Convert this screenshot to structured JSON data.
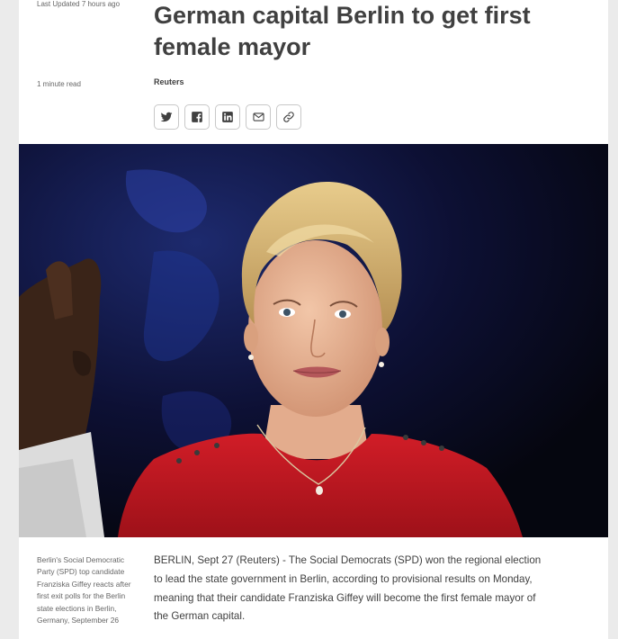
{
  "article": {
    "updated": "Last Updated 7 hours ago",
    "headline": "German capital Berlin to get first female mayor",
    "read_time": "1 minute read",
    "byline": "Reuters",
    "share": [
      {
        "icon": "twitter-icon"
      },
      {
        "icon": "facebook-icon"
      },
      {
        "icon": "linkedin-icon"
      },
      {
        "icon": "email-icon"
      },
      {
        "icon": "link-icon"
      }
    ],
    "caption": "Berlin's Social Democratic Party (SPD) top candidate Franziska Giffey reacts after first exit polls for the Berlin state elections in Berlin, Germany, September 26",
    "body": "BERLIN, Sept 27 (Reuters) - The Social Democrats (SPD) won the regional election to lead the state government in Berlin, according to provisional results on Monday, meaning that their candidate Franziska Giffey will become the first female mayor of the German capital."
  },
  "colors": {
    "page_bg": "#ebebeb",
    "text": "#404040",
    "muted": "#666666",
    "hero_bg": "#0a0c22",
    "dress": "#c2171f"
  }
}
